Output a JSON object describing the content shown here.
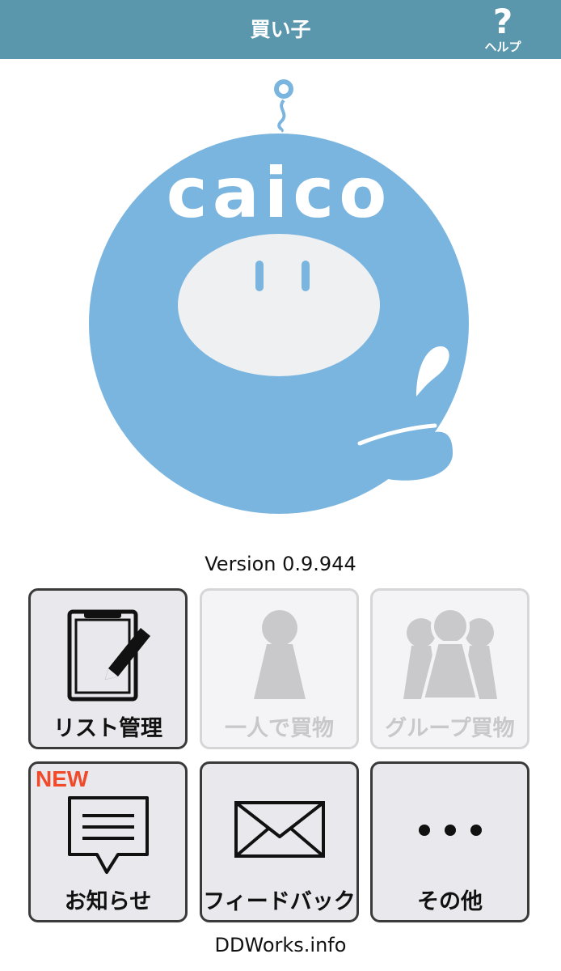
{
  "header": {
    "title": "買い子",
    "help_label": "ヘルプ",
    "help_mark": "?",
    "background": "#5a97ad"
  },
  "logo": {
    "wordmark": "caico",
    "color": "#7ab5df"
  },
  "version_text": "Version 0.9.944",
  "menu": {
    "list_manage": {
      "label": "リスト管理",
      "icon": "clipboard-pencil-icon",
      "enabled": true
    },
    "solo_shopping": {
      "label": "一人で買物",
      "icon": "person-icon",
      "enabled": false
    },
    "group_shopping": {
      "label": "グループ買物",
      "icon": "group-icon",
      "enabled": false
    },
    "news": {
      "label": "お知らせ",
      "icon": "message-icon",
      "badge": "NEW",
      "enabled": true
    },
    "feedback": {
      "label": "フィードバック",
      "icon": "envelope-icon",
      "enabled": true
    },
    "other": {
      "label": "その他",
      "icon": "more-dots-icon",
      "enabled": true
    }
  },
  "footer_text": "DDWorks.info"
}
